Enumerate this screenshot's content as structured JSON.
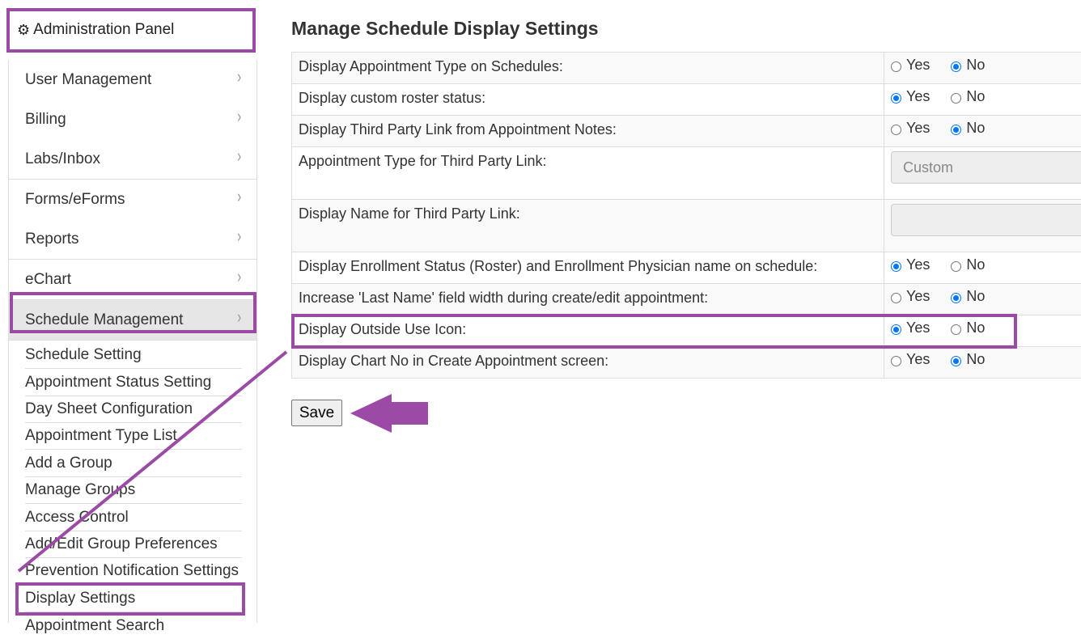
{
  "sidebar": {
    "header": {
      "icon": "gear-icon",
      "label": "Administration Panel"
    },
    "items": [
      {
        "label": "User Management"
      },
      {
        "label": "Billing"
      },
      {
        "label": "Labs/Inbox"
      },
      {
        "label": "Forms/eForms"
      },
      {
        "label": "Reports"
      },
      {
        "label": "eChart"
      },
      {
        "label": "Schedule Management"
      }
    ],
    "chevron": "›",
    "submenu": [
      {
        "label": "Schedule Setting"
      },
      {
        "label": "Appointment Status Setting"
      },
      {
        "label": "Day Sheet Configuration"
      },
      {
        "label": "Appointment Type List"
      },
      {
        "label": "Add a Group"
      },
      {
        "label": "Manage Groups"
      },
      {
        "label": "Access Control"
      },
      {
        "label": "Add/Edit Group Preferences"
      },
      {
        "label": "Prevention Notification Settings"
      },
      {
        "label": "Display Settings"
      },
      {
        "label": "Appointment Search"
      }
    ]
  },
  "main": {
    "title": "Manage Schedule Display Settings",
    "radio_yes": "Yes",
    "radio_no": "No",
    "rows": [
      {
        "label": "Display Appointment Type on Schedules:",
        "value": "No"
      },
      {
        "label": "Display custom roster status:",
        "value": "Yes"
      },
      {
        "label": "Display Third Party Link from Appointment Notes:",
        "value": "No"
      },
      {
        "label": "Appointment Type for Third Party Link:",
        "select_value": "Custom"
      },
      {
        "label": "Display Name for Third Party Link:",
        "input_value": ""
      },
      {
        "label": "Display Enrollment Status (Roster) and Enrollment Physician name on schedule:",
        "value": "Yes"
      },
      {
        "label": "Increase 'Last Name' field width during create/edit appointment:",
        "value": "No"
      },
      {
        "label": "Display Outside Use Icon:",
        "value": "Yes"
      },
      {
        "label": "Display Chart No in Create Appointment screen:",
        "value": "No"
      }
    ],
    "save_label": "Save"
  },
  "annotation_color": "#9b4aa6"
}
